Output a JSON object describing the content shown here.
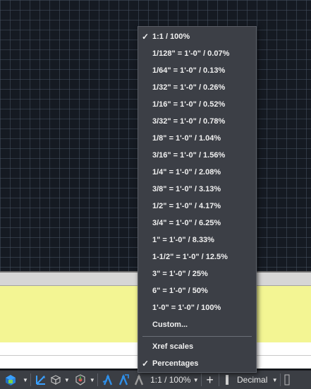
{
  "scale_menu": {
    "items": [
      {
        "label": "1:1 / 100%",
        "checked": true
      },
      {
        "label": "1/128\" = 1'-0\" / 0.07%",
        "checked": false
      },
      {
        "label": "1/64\" = 1'-0\" / 0.13%",
        "checked": false
      },
      {
        "label": "1/32\" = 1'-0\" / 0.26%",
        "checked": false
      },
      {
        "label": "1/16\" = 1'-0\" / 0.52%",
        "checked": false
      },
      {
        "label": "3/32\" = 1'-0\" / 0.78%",
        "checked": false
      },
      {
        "label": "1/8\" = 1'-0\" / 1.04%",
        "checked": false
      },
      {
        "label": "3/16\" = 1'-0\" / 1.56%",
        "checked": false
      },
      {
        "label": "1/4\" = 1'-0\" / 2.08%",
        "checked": false
      },
      {
        "label": "3/8\" = 1'-0\" / 3.13%",
        "checked": false
      },
      {
        "label": "1/2\" = 1'-0\" / 4.17%",
        "checked": false
      },
      {
        "label": "3/4\" = 1'-0\" / 6.25%",
        "checked": false
      },
      {
        "label": "1\" = 1'-0\" / 8.33%",
        "checked": false
      },
      {
        "label": "1-1/2\" = 1'-0\" / 12.5%",
        "checked": false
      },
      {
        "label": "3\" = 1'-0\" / 25%",
        "checked": false
      },
      {
        "label": "6\" = 1'-0\" / 50%",
        "checked": false
      },
      {
        "label": "1'-0\" = 1'-0\" / 100%",
        "checked": false
      },
      {
        "label": "Custom...",
        "checked": false
      }
    ],
    "options": [
      {
        "label": "Xref scales",
        "checked": false
      },
      {
        "label": "Percentages",
        "checked": true
      }
    ],
    "check_glyph": "✓"
  },
  "statusbar": {
    "annotation_scale": "1:1 / 100%",
    "units": "Decimal"
  },
  "colors": {
    "menu_bg": "#3c3f46",
    "status_bg": "#3b3e44",
    "accent_blue": "#2f8fe8",
    "panel_yellow": "#f3f593"
  }
}
